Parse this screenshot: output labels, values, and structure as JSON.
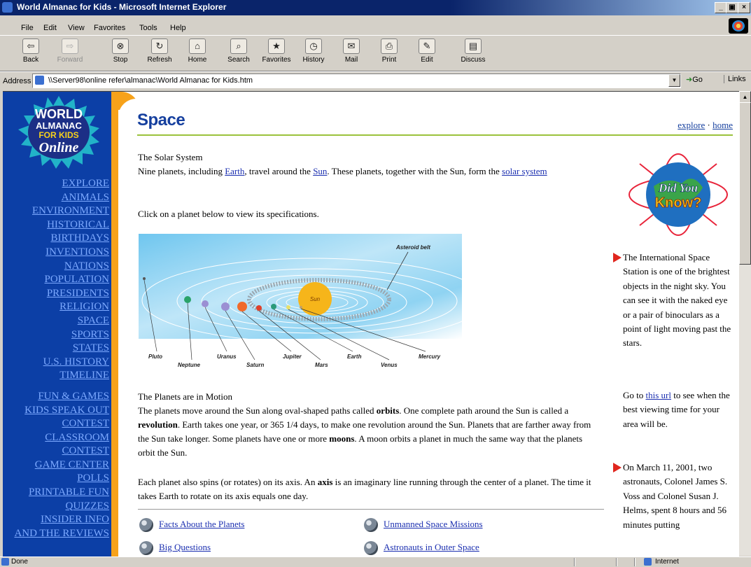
{
  "window": {
    "title": "World Almanac for Kids - Microsoft Internet Explorer",
    "controls": [
      "_",
      "▣",
      "×"
    ]
  },
  "menu": [
    "File",
    "Edit",
    "View",
    "Favorites",
    "Tools",
    "Help"
  ],
  "toolbar": [
    {
      "label": "Back",
      "icon": "back-arrow-icon",
      "glyph": "⇦"
    },
    {
      "label": "Forward",
      "icon": "forward-arrow-icon",
      "glyph": "⇨"
    },
    {
      "label": "Stop",
      "icon": "stop-icon",
      "glyph": "⊗"
    },
    {
      "label": "Refresh",
      "icon": "refresh-icon",
      "glyph": "↻"
    },
    {
      "label": "Home",
      "icon": "home-icon",
      "glyph": "⌂"
    },
    {
      "label": "Search",
      "icon": "search-icon",
      "glyph": "⌕"
    },
    {
      "label": "Favorites",
      "icon": "favorites-icon",
      "glyph": "★"
    },
    {
      "label": "History",
      "icon": "history-icon",
      "glyph": "◷"
    },
    {
      "label": "Mail",
      "icon": "mail-icon",
      "glyph": "✉"
    },
    {
      "label": "Print",
      "icon": "print-icon",
      "glyph": "⎙"
    },
    {
      "label": "Edit",
      "icon": "edit-icon",
      "glyph": "✎"
    },
    {
      "label": "Discuss",
      "icon": "discuss-icon",
      "glyph": "▤"
    }
  ],
  "address": {
    "label": "Address",
    "url": "\\\\Server98\\online refer\\almanac\\World Almanac for Kids.htm",
    "go": "Go",
    "links": "Links"
  },
  "status": {
    "text": "Done",
    "zone": "Internet"
  },
  "sidebar": {
    "logo": {
      "line1": "WORLD",
      "line2": "ALMANAC",
      "line3": "FOR KIDS",
      "line4": "Online"
    },
    "links": [
      "EXPLORE",
      "ANIMALS",
      "ENVIRONMENT",
      "HISTORICAL",
      "BIRTHDAYS",
      "INVENTIONS",
      "NATIONS",
      "POPULATION",
      "PRESIDENTS",
      "RELIGION",
      "SPACE",
      "SPORTS",
      "STATES",
      "U.S. HISTORY",
      "TIMELINE"
    ],
    "links2": [
      "FUN & GAMES",
      "KIDS SPEAK OUT",
      "CONTEST",
      "CLASSROOM",
      "CONTEST",
      "GAME CENTER",
      "POLLS",
      "PRINTABLE FUN",
      "QUIZZES",
      "INSIDER INFO",
      "AND THE REVIEWS"
    ]
  },
  "page": {
    "title": "Space",
    "top_links": {
      "explore": "explore",
      "sep": "·",
      "home": "home"
    },
    "intro_heading": "The Solar System",
    "intro": {
      "t1": "Nine planets, including ",
      "earth": "Earth",
      "t2": ", travel around the ",
      "sun": "Sun",
      "t3": ". These planets, together with the Sun, form the ",
      "solar_system": "solar system"
    },
    "click_hint": "Click on a planet below to view its specifications.",
    "motion_heading": "The Planets are in Motion",
    "motion": {
      "t1": "The planets move around the Sun along oval-shaped paths called ",
      "orbits": "orbits",
      "t2": ". One complete path around the Sun is called a ",
      "revolution": "revolution",
      "t3": ". Earth takes one year, or 365 1/4 days, to make one revolution around the Sun. Planets that are farther away from the Sun take longer. Some planets have one or more ",
      "moons": "moons",
      "t4": ". A moon orbits a planet in much the same way that the planets orbit the Sun."
    },
    "axis": {
      "t1": "Each planet also spins (or rotates) on its axis. An ",
      "axis": "axis",
      "t2": " is an imaginary line running through the center of a planet. The time it takes Earth to rotate on its axis equals one day."
    },
    "footer_links": [
      "Facts About the Planets",
      "Unmanned Space Missions",
      "Big Questions",
      "Astronauts in Outer Space"
    ]
  },
  "diagram": {
    "sun": "Sun",
    "asteroid_belt": "Asteroid belt",
    "planets": [
      "Pluto",
      "Neptune",
      "Uranus",
      "Saturn",
      "Jupiter",
      "Mars",
      "Earth",
      "Venus",
      "Mercury"
    ]
  },
  "did_you_know": {
    "line1": "Did You",
    "line2": "Know?",
    "fact1": "The International Space Station is one of the brightest objects in the night sky. You can see it with the naked eye or a pair of binoculars as a point of light moving past the stars.",
    "go_to": {
      "t1": "Go to ",
      "link": "this url",
      "t2": " to see when the best viewing time for your area will be."
    },
    "fact2": "On March 11, 2001, two astronauts, Colonel James S. Voss and Colonel Susan J. Helms, spent 8 hours and 56 minutes putting"
  }
}
